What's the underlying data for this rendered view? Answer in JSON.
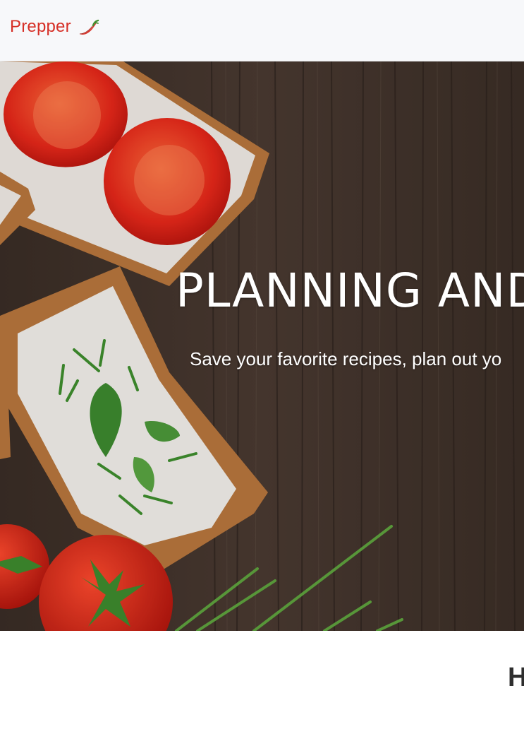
{
  "navbar": {
    "brand_name": "Prepper",
    "brand_icon": "chili-pepper-icon",
    "brand_color": "#d62f26",
    "background": "#f7f8fa"
  },
  "hero": {
    "title": "PLANNING AND",
    "subtitle": "Save your favorite recipes, plan out yo",
    "background_image": "bruschetta-on-wood-photo"
  },
  "section": {
    "heading": "H"
  }
}
